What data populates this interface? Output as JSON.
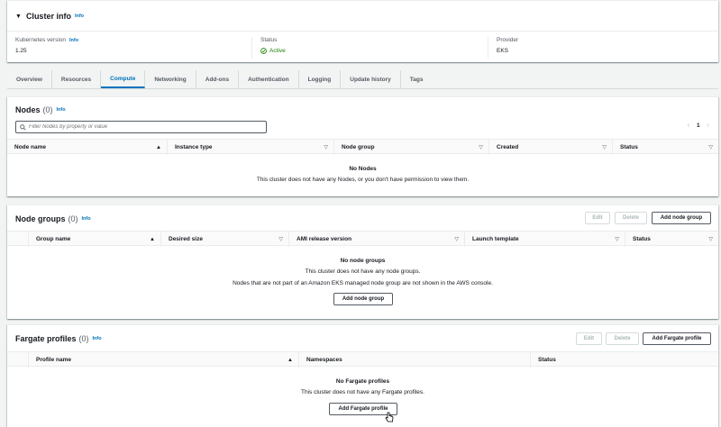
{
  "cluster_info": {
    "title": "Cluster info",
    "info": "Info",
    "k8s_label": "Kubernetes version",
    "k8s_info": "Info",
    "k8s_value": "1.25",
    "status_label": "Status",
    "status_value": "Active",
    "provider_label": "Provider",
    "provider_value": "EKS"
  },
  "tabs": [
    "Overview",
    "Resources",
    "Compute",
    "Networking",
    "Add-ons",
    "Authentication",
    "Logging",
    "Update history",
    "Tags"
  ],
  "nodes": {
    "title": "Nodes",
    "count": "(0)",
    "info": "Info",
    "search_placeholder": "Filter Nodes by property or value",
    "page": "1",
    "columns": [
      "Node name",
      "Instance type",
      "Node group",
      "Created",
      "Status"
    ],
    "empty_title": "No Nodes",
    "empty_desc": "This cluster does not have any Nodes, or you don't have permission to view them."
  },
  "node_groups": {
    "title": "Node groups",
    "count": "(0)",
    "info": "Info",
    "edit": "Edit",
    "delete": "Delete",
    "add": "Add node group",
    "columns": [
      "Group name",
      "Desired size",
      "AMI release version",
      "Launch template",
      "Status"
    ],
    "empty_title": "No node groups",
    "empty_desc": "This cluster does not have any node groups.",
    "empty_note": "Nodes that are not part of an Amazon EKS managed node group are not shown in the AWS console.",
    "empty_btn": "Add node group"
  },
  "fargate": {
    "title": "Fargate profiles",
    "count": "(0)",
    "info": "Info",
    "edit": "Edit",
    "delete": "Delete",
    "add": "Add Fargate profile",
    "columns": [
      "Profile name",
      "Namespaces",
      "Status"
    ],
    "empty_title": "No Fargate profiles",
    "empty_desc": "This cluster does not have any Fargate profiles.",
    "empty_btn": "Add Fargate profile"
  },
  "colors": {
    "accent": "#0073bb",
    "success": "#1d8102"
  }
}
